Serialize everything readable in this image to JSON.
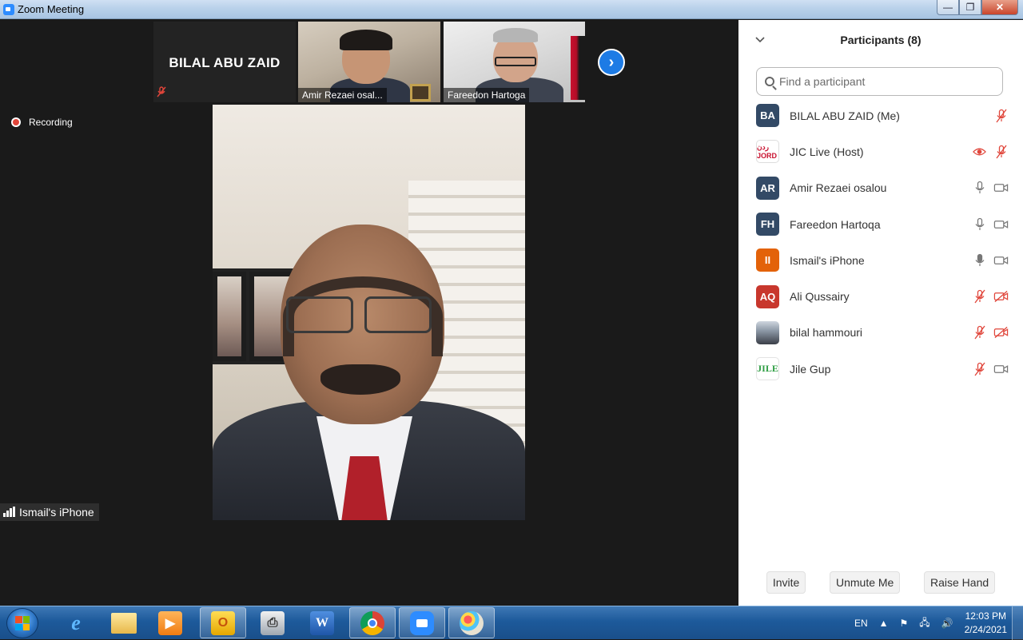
{
  "window": {
    "title": "Zoom Meeting",
    "minimize_label": "—",
    "maximize_label": "❐",
    "close_label": "✕"
  },
  "gallery": {
    "thumbnails": [
      {
        "name": "BILAL ABU ZAID",
        "video": false,
        "muted": true
      },
      {
        "name": "Amir Rezaei osal...",
        "video": true
      },
      {
        "name": "Fareedon Hartoga",
        "video": true
      }
    ],
    "next_label": "›"
  },
  "recording": {
    "label": "Recording"
  },
  "active_speaker": {
    "name": "Ismail's iPhone"
  },
  "participants_panel": {
    "title": "Participants (8)",
    "collapse_icon": "chevron-down-icon",
    "search_placeholder": "Find a participant",
    "participants": [
      {
        "initials": "BA",
        "name": "BILAL ABU ZAID (Me)",
        "avatar_color": "#334a66",
        "mic": "muted",
        "video": "none"
      },
      {
        "initials": "ردن JORD",
        "name": "JIC Live (Host)",
        "avatar_color": "logo",
        "mic": "muted",
        "video": "recording"
      },
      {
        "initials": "AR",
        "name": "Amir Rezaei osalou",
        "avatar_color": "#334a66",
        "mic": "on",
        "video": "on"
      },
      {
        "initials": "FH",
        "name": "Fareedon Hartoqa",
        "avatar_color": "#334a66",
        "mic": "on",
        "video": "on"
      },
      {
        "initials": "II",
        "name": "Ismail's iPhone",
        "avatar_color": "#e36209",
        "mic": "active",
        "video": "on"
      },
      {
        "initials": "AQ",
        "name": "Ali Qussairy",
        "avatar_color": "#c8372d",
        "mic": "muted",
        "video": "off"
      },
      {
        "initials": "",
        "name": "bilal hammouri",
        "avatar_color": "photo",
        "mic": "muted",
        "video": "off"
      },
      {
        "initials": "JILE",
        "name": "Jile Gup",
        "avatar_color": "jile",
        "mic": "muted",
        "video": "on"
      }
    ],
    "buttons": {
      "invite": "Invite",
      "unmute": "Unmute Me",
      "raise_hand": "Raise Hand"
    }
  },
  "colors": {
    "mute_red": "#e0453a",
    "icon_gray": "#777777",
    "accent_blue": "#1d7be5"
  },
  "taskbar": {
    "apps": [
      "internet-explorer",
      "file-explorer",
      "media-player",
      "outlook",
      "fax-printer",
      "word",
      "chrome",
      "zoom",
      "paint"
    ],
    "language": "EN",
    "time": "12:03 PM",
    "date": "2/24/2021"
  }
}
